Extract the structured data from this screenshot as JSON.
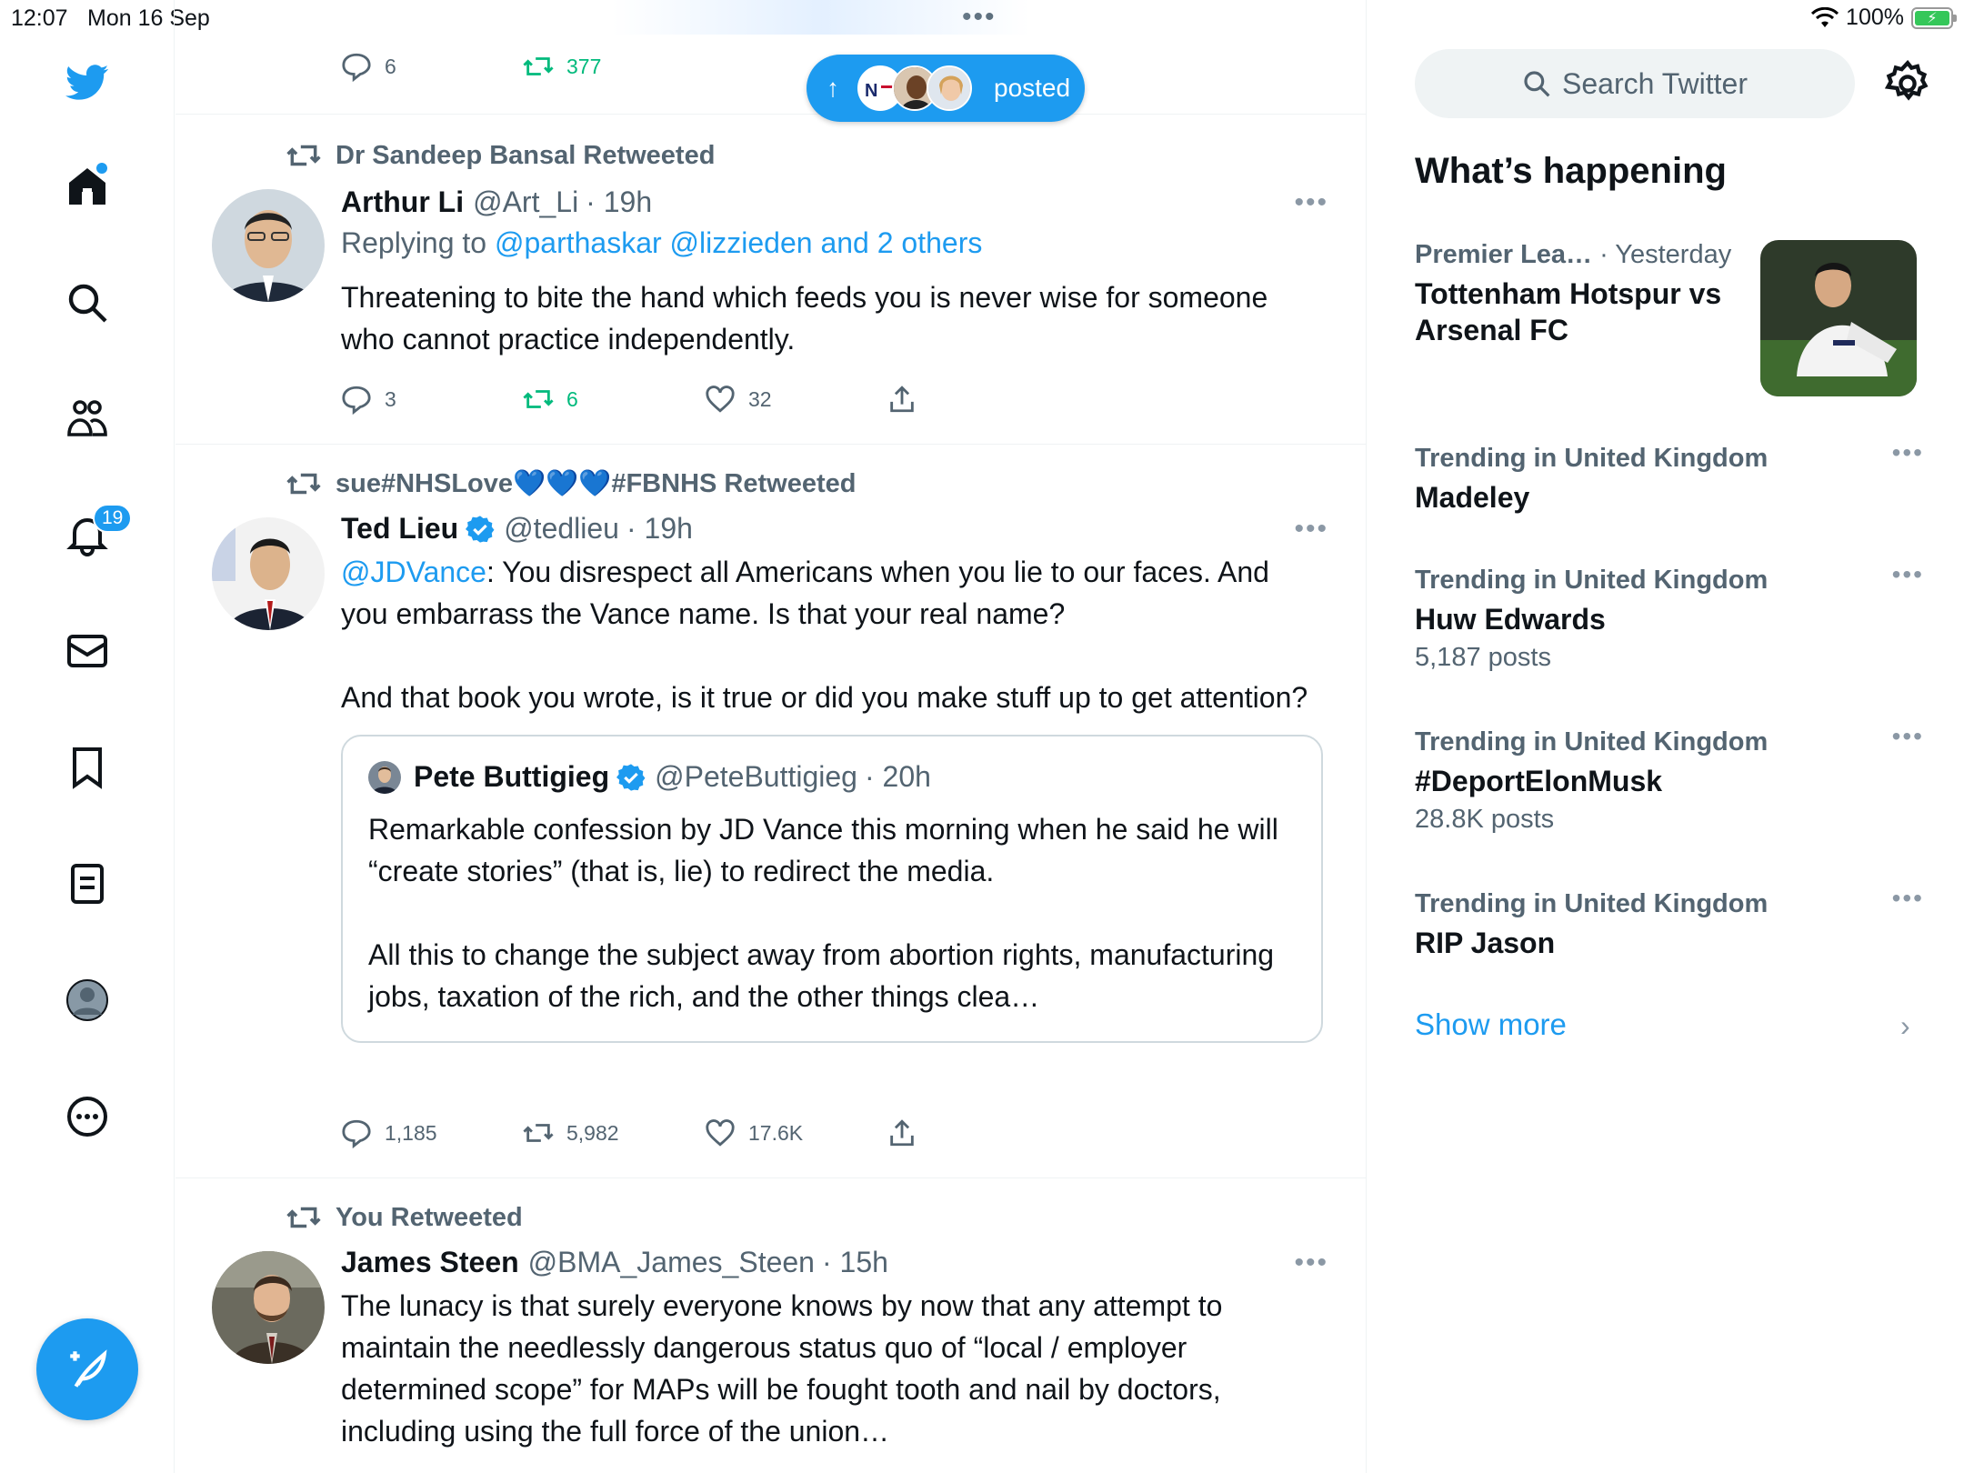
{
  "status_bar": {
    "time": "12:07",
    "date": "Mon 16 Sep",
    "battery": "100%"
  },
  "nav": {
    "notifications_count": "19"
  },
  "posted_pill": {
    "label": "posted"
  },
  "tweets": [
    {
      "actions": {
        "replies": "6",
        "retweets": "377"
      }
    },
    {
      "retweeted_by": "Dr Sandeep Bansal Retweeted",
      "name": "Arthur Li",
      "handle": "@Art_Li",
      "time": "· 19h",
      "replying_prefix": "Replying to",
      "replying_to": "@parthaskar @lizzieden and 2 others",
      "text": "Threatening to bite the hand which feeds you is never wise for someone who cannot practice independently.",
      "actions": {
        "replies": "3",
        "retweets": "6",
        "likes": "32"
      }
    },
    {
      "retweeted_by": "sue#NHSLove💙💙💙#FBNHS Retweeted",
      "name": "Ted Lieu",
      "handle": "@tedlieu",
      "time": "· 19h",
      "mention": "@JDVance",
      "text_a": ": You disrespect all Americans when you lie to our faces. And you embarrass the Vance name. Is that your real name?",
      "text_b": "And that book you wrote, is it true or did you make stuff up to get attention?",
      "quote": {
        "name": "Pete Buttigieg",
        "handle": "@PeteButtigieg",
        "time": "· 20h",
        "text_a": "Remarkable confession by JD Vance this morning when he said he will “create stories” (that is, lie) to redirect the media.",
        "text_b": "All this to change the subject away from abortion rights, manufacturing jobs, taxation of the rich, and the other things clea…"
      },
      "actions": {
        "replies": "1,185",
        "retweets": "5,982",
        "likes": "17.6K"
      }
    },
    {
      "retweeted_by": "You Retweeted",
      "name": "James Steen",
      "handle": "@BMA_James_Steen",
      "time": "· 15h",
      "text": "The lunacy is that surely everyone knows by now that any attempt to maintain the needlessly dangerous status quo of “local / employer determined scope” for MAPs will be fought tooth and nail by doctors, including using the full force of the union…"
    }
  ],
  "sidebar": {
    "search_placeholder": "Search Twitter",
    "whats_happening": "What’s happening",
    "featured": {
      "category": "Premier Lea…",
      "time": "· Yesterday",
      "title": "Tottenham Hotspur vs Arsenal FC"
    },
    "trends": [
      {
        "meta": "Trending in United Kingdom",
        "name": "Madeley",
        "count": ""
      },
      {
        "meta": "Trending in United Kingdom",
        "name": "Huw Edwards",
        "count": "5,187 posts"
      },
      {
        "meta": "Trending in United Kingdom",
        "name": "#DeportElonMusk",
        "count": "28.8K posts"
      },
      {
        "meta": "Trending in United Kingdom",
        "name": "RIP Jason",
        "count": ""
      }
    ],
    "show_more": "Show more"
  },
  "colors": {
    "accent": "#1d9bf0",
    "retweet_green": "#00ba7c",
    "muted": "#536471"
  }
}
